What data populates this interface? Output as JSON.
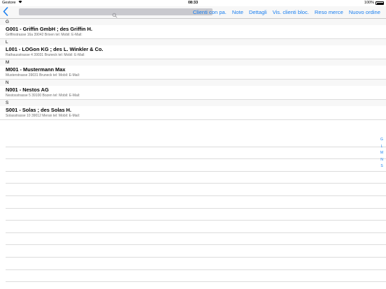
{
  "status_bar": {
    "carrier": "Gestore",
    "time": "08:33",
    "battery": "100%"
  },
  "nav": {
    "actions": [
      "Clienti con pa.",
      "Note",
      "Dettagli",
      "Vis. clienti bloc.",
      "Reso merce",
      "Nuovo ordine"
    ]
  },
  "sections": [
    {
      "letter": "G",
      "title": "G001 - Griffin GmbH ; des Griffin H.",
      "subtitle": "Griffinstrasse 16a 39042 Brixen  tel:   Mobil:  E-Mail:"
    },
    {
      "letter": "L",
      "title": "L001 - LOGon KG ; des L. Winkler & Co.",
      "subtitle": "Rathausstrasse 4 39031 Bruneck  tel:   Mobil:  E-Mail:"
    },
    {
      "letter": "M",
      "title": "M001 - Mustermann Max",
      "subtitle": "Musterstrasse 39031 Bruneck  tel:   Mobil:  E-Mail:"
    },
    {
      "letter": "N",
      "title": "N001 - Nestos AG",
      "subtitle": "Nestosstrasse 5 39100 Bozen  tel:   Mobil:  E-Mail:"
    },
    {
      "letter": "S",
      "title": "S001 - Solas ; des Solas H.",
      "subtitle": "Solasstrasse 10 39012 Meran  tel:   Mobil:  E-Mail:"
    }
  ],
  "index_letters": [
    "G",
    "L",
    "M",
    "N",
    "S"
  ],
  "colors": {
    "accent": "#1a7ff0",
    "search_bg": "#c9c9ce",
    "header_bg": "#f7f7f7"
  }
}
